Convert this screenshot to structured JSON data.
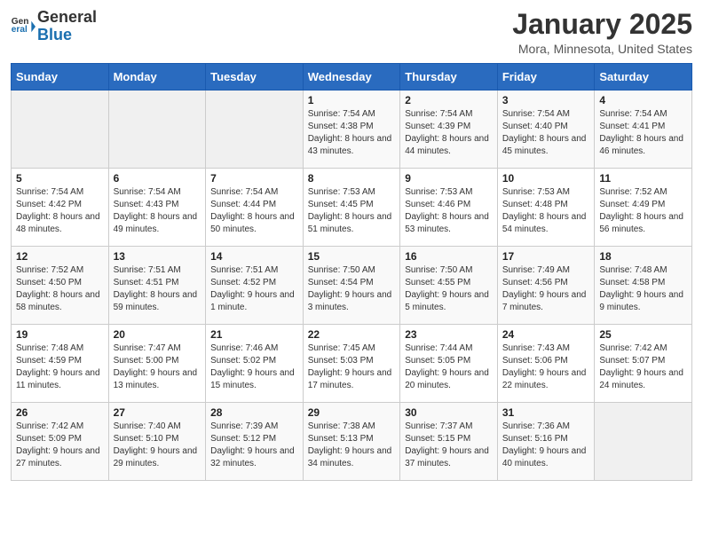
{
  "header": {
    "logo_general": "General",
    "logo_blue": "Blue",
    "month_title": "January 2025",
    "location": "Mora, Minnesota, United States"
  },
  "weekdays": [
    "Sunday",
    "Monday",
    "Tuesday",
    "Wednesday",
    "Thursday",
    "Friday",
    "Saturday"
  ],
  "weeks": [
    [
      {
        "day": "",
        "sunrise": "",
        "sunset": "",
        "daylight": ""
      },
      {
        "day": "",
        "sunrise": "",
        "sunset": "",
        "daylight": ""
      },
      {
        "day": "",
        "sunrise": "",
        "sunset": "",
        "daylight": ""
      },
      {
        "day": "1",
        "sunrise": "Sunrise: 7:54 AM",
        "sunset": "Sunset: 4:38 PM",
        "daylight": "Daylight: 8 hours and 43 minutes."
      },
      {
        "day": "2",
        "sunrise": "Sunrise: 7:54 AM",
        "sunset": "Sunset: 4:39 PM",
        "daylight": "Daylight: 8 hours and 44 minutes."
      },
      {
        "day": "3",
        "sunrise": "Sunrise: 7:54 AM",
        "sunset": "Sunset: 4:40 PM",
        "daylight": "Daylight: 8 hours and 45 minutes."
      },
      {
        "day": "4",
        "sunrise": "Sunrise: 7:54 AM",
        "sunset": "Sunset: 4:41 PM",
        "daylight": "Daylight: 8 hours and 46 minutes."
      }
    ],
    [
      {
        "day": "5",
        "sunrise": "Sunrise: 7:54 AM",
        "sunset": "Sunset: 4:42 PM",
        "daylight": "Daylight: 8 hours and 48 minutes."
      },
      {
        "day": "6",
        "sunrise": "Sunrise: 7:54 AM",
        "sunset": "Sunset: 4:43 PM",
        "daylight": "Daylight: 8 hours and 49 minutes."
      },
      {
        "day": "7",
        "sunrise": "Sunrise: 7:54 AM",
        "sunset": "Sunset: 4:44 PM",
        "daylight": "Daylight: 8 hours and 50 minutes."
      },
      {
        "day": "8",
        "sunrise": "Sunrise: 7:53 AM",
        "sunset": "Sunset: 4:45 PM",
        "daylight": "Daylight: 8 hours and 51 minutes."
      },
      {
        "day": "9",
        "sunrise": "Sunrise: 7:53 AM",
        "sunset": "Sunset: 4:46 PM",
        "daylight": "Daylight: 8 hours and 53 minutes."
      },
      {
        "day": "10",
        "sunrise": "Sunrise: 7:53 AM",
        "sunset": "Sunset: 4:48 PM",
        "daylight": "Daylight: 8 hours and 54 minutes."
      },
      {
        "day": "11",
        "sunrise": "Sunrise: 7:52 AM",
        "sunset": "Sunset: 4:49 PM",
        "daylight": "Daylight: 8 hours and 56 minutes."
      }
    ],
    [
      {
        "day": "12",
        "sunrise": "Sunrise: 7:52 AM",
        "sunset": "Sunset: 4:50 PM",
        "daylight": "Daylight: 8 hours and 58 minutes."
      },
      {
        "day": "13",
        "sunrise": "Sunrise: 7:51 AM",
        "sunset": "Sunset: 4:51 PM",
        "daylight": "Daylight: 8 hours and 59 minutes."
      },
      {
        "day": "14",
        "sunrise": "Sunrise: 7:51 AM",
        "sunset": "Sunset: 4:52 PM",
        "daylight": "Daylight: 9 hours and 1 minute."
      },
      {
        "day": "15",
        "sunrise": "Sunrise: 7:50 AM",
        "sunset": "Sunset: 4:54 PM",
        "daylight": "Daylight: 9 hours and 3 minutes."
      },
      {
        "day": "16",
        "sunrise": "Sunrise: 7:50 AM",
        "sunset": "Sunset: 4:55 PM",
        "daylight": "Daylight: 9 hours and 5 minutes."
      },
      {
        "day": "17",
        "sunrise": "Sunrise: 7:49 AM",
        "sunset": "Sunset: 4:56 PM",
        "daylight": "Daylight: 9 hours and 7 minutes."
      },
      {
        "day": "18",
        "sunrise": "Sunrise: 7:48 AM",
        "sunset": "Sunset: 4:58 PM",
        "daylight": "Daylight: 9 hours and 9 minutes."
      }
    ],
    [
      {
        "day": "19",
        "sunrise": "Sunrise: 7:48 AM",
        "sunset": "Sunset: 4:59 PM",
        "daylight": "Daylight: 9 hours and 11 minutes."
      },
      {
        "day": "20",
        "sunrise": "Sunrise: 7:47 AM",
        "sunset": "Sunset: 5:00 PM",
        "daylight": "Daylight: 9 hours and 13 minutes."
      },
      {
        "day": "21",
        "sunrise": "Sunrise: 7:46 AM",
        "sunset": "Sunset: 5:02 PM",
        "daylight": "Daylight: 9 hours and 15 minutes."
      },
      {
        "day": "22",
        "sunrise": "Sunrise: 7:45 AM",
        "sunset": "Sunset: 5:03 PM",
        "daylight": "Daylight: 9 hours and 17 minutes."
      },
      {
        "day": "23",
        "sunrise": "Sunrise: 7:44 AM",
        "sunset": "Sunset: 5:05 PM",
        "daylight": "Daylight: 9 hours and 20 minutes."
      },
      {
        "day": "24",
        "sunrise": "Sunrise: 7:43 AM",
        "sunset": "Sunset: 5:06 PM",
        "daylight": "Daylight: 9 hours and 22 minutes."
      },
      {
        "day": "25",
        "sunrise": "Sunrise: 7:42 AM",
        "sunset": "Sunset: 5:07 PM",
        "daylight": "Daylight: 9 hours and 24 minutes."
      }
    ],
    [
      {
        "day": "26",
        "sunrise": "Sunrise: 7:42 AM",
        "sunset": "Sunset: 5:09 PM",
        "daylight": "Daylight: 9 hours and 27 minutes."
      },
      {
        "day": "27",
        "sunrise": "Sunrise: 7:40 AM",
        "sunset": "Sunset: 5:10 PM",
        "daylight": "Daylight: 9 hours and 29 minutes."
      },
      {
        "day": "28",
        "sunrise": "Sunrise: 7:39 AM",
        "sunset": "Sunset: 5:12 PM",
        "daylight": "Daylight: 9 hours and 32 minutes."
      },
      {
        "day": "29",
        "sunrise": "Sunrise: 7:38 AM",
        "sunset": "Sunset: 5:13 PM",
        "daylight": "Daylight: 9 hours and 34 minutes."
      },
      {
        "day": "30",
        "sunrise": "Sunrise: 7:37 AM",
        "sunset": "Sunset: 5:15 PM",
        "daylight": "Daylight: 9 hours and 37 minutes."
      },
      {
        "day": "31",
        "sunrise": "Sunrise: 7:36 AM",
        "sunset": "Sunset: 5:16 PM",
        "daylight": "Daylight: 9 hours and 40 minutes."
      },
      {
        "day": "",
        "sunrise": "",
        "sunset": "",
        "daylight": ""
      }
    ]
  ]
}
